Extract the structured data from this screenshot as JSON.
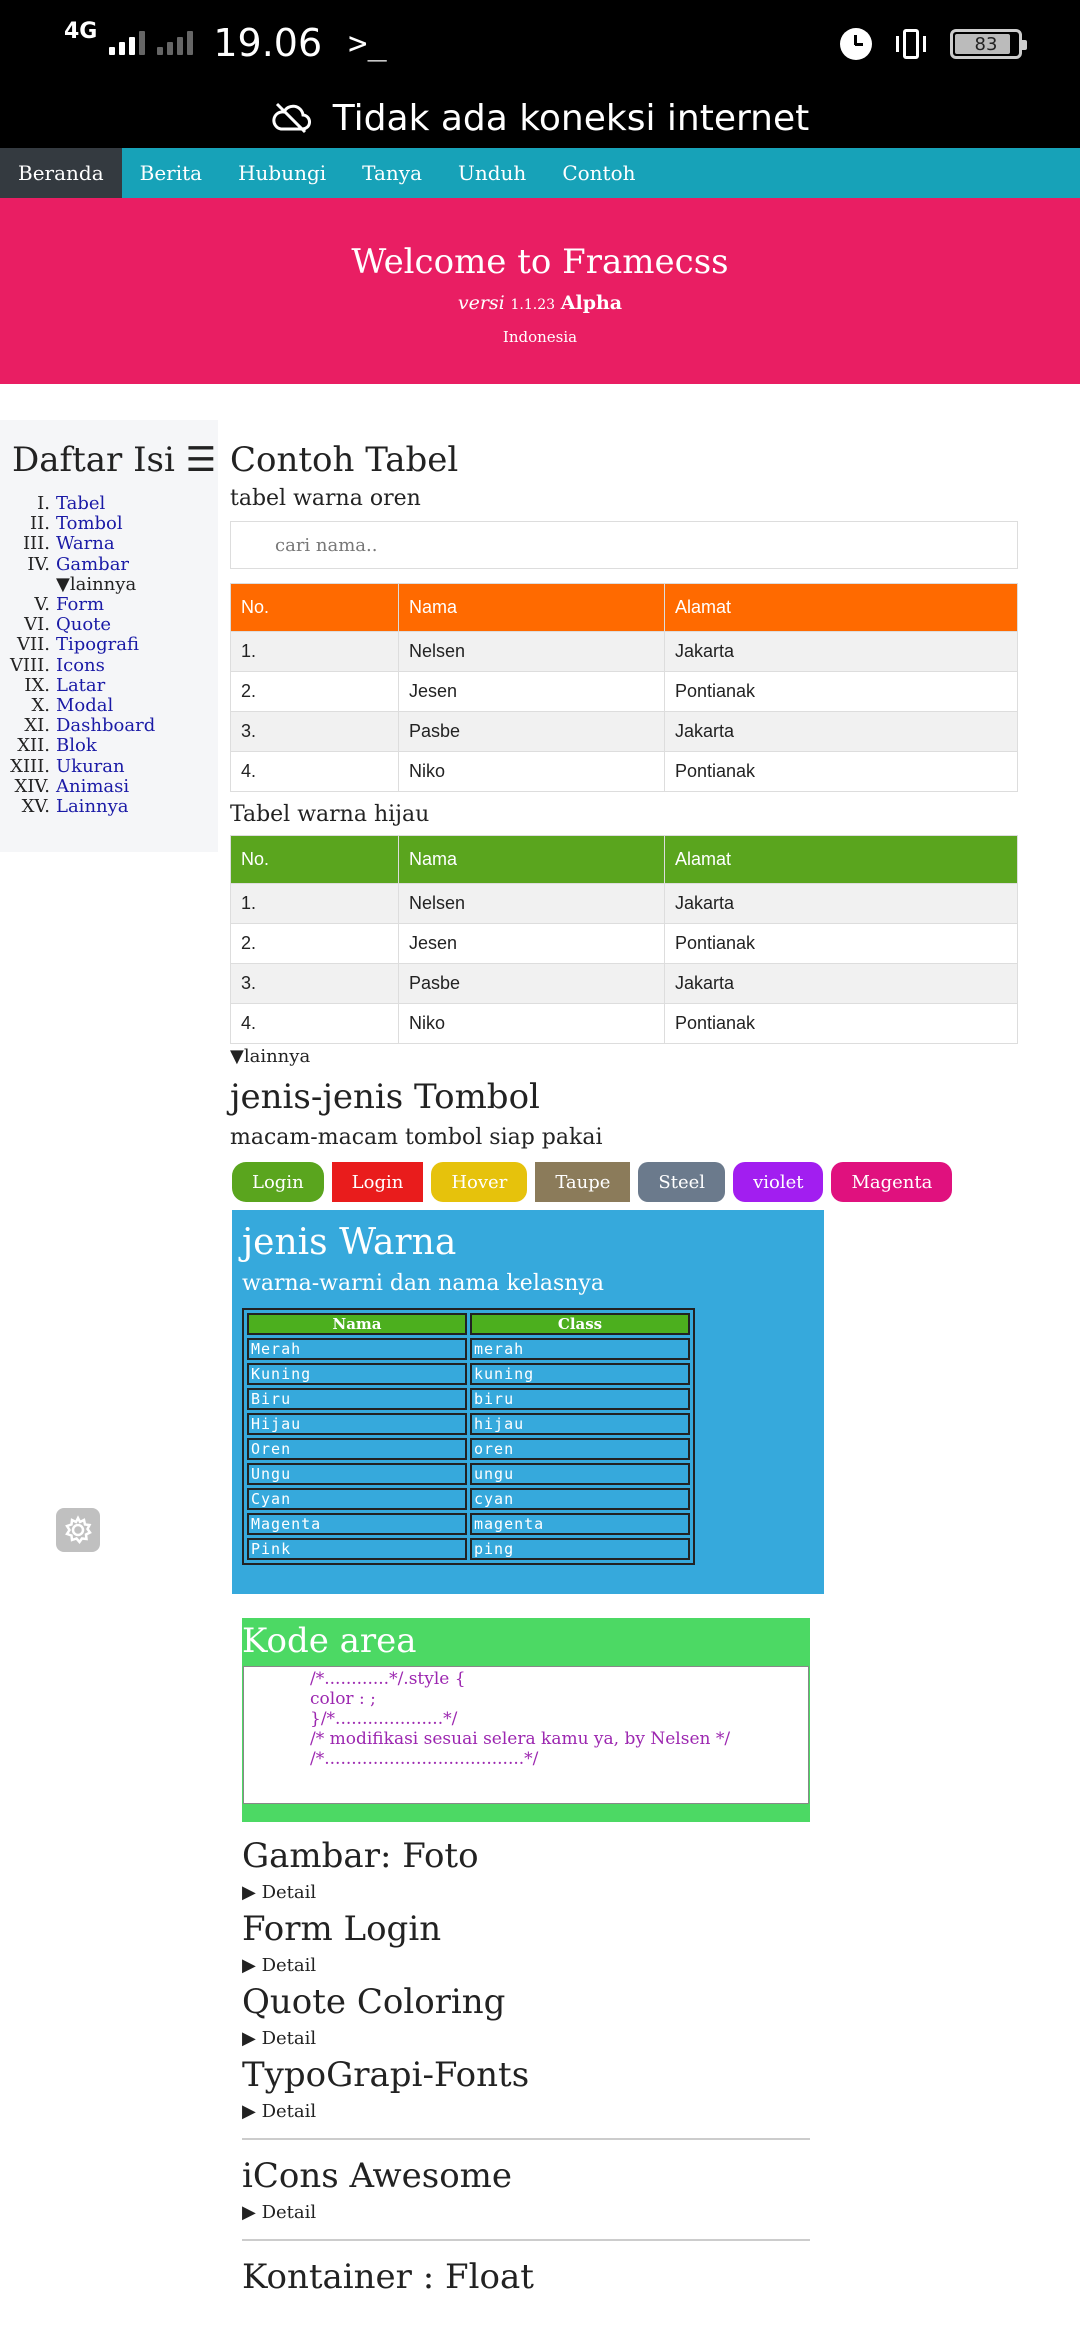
{
  "status": {
    "network": "4G",
    "time": "19.06",
    "prompt": ">_",
    "battery": "83"
  },
  "offline": {
    "message": "Tidak ada koneksi internet"
  },
  "nav": {
    "items": [
      "Beranda",
      "Berita",
      "Hubungi",
      "Tanya",
      "Unduh",
      "Contoh"
    ]
  },
  "hero": {
    "title": "Welcome to Framecss",
    "version_prefix": "versi",
    "version_number": "1.1.23",
    "version_stage": "Alpha",
    "country": "Indonesia"
  },
  "sidebar": {
    "title": "Daftar Isi ☰",
    "items": [
      {
        "num": "I.",
        "label": "Tabel"
      },
      {
        "num": "II.",
        "label": "Tombol"
      },
      {
        "num": "III.",
        "label": "Warna"
      },
      {
        "num": "IV.",
        "label": "Gambar"
      },
      {
        "num": "V.",
        "label": "Form"
      },
      {
        "num": "VI.",
        "label": "Quote"
      },
      {
        "num": "VII.",
        "label": "Tipografi"
      },
      {
        "num": "VIII.",
        "label": "Icons"
      },
      {
        "num": "IX.",
        "label": "Latar"
      },
      {
        "num": "X.",
        "label": "Modal"
      },
      {
        "num": "XI.",
        "label": "Dashboard"
      },
      {
        "num": "XII.",
        "label": "Blok"
      },
      {
        "num": "XIII.",
        "label": "Ukuran"
      },
      {
        "num": "XIV.",
        "label": "Animasi"
      },
      {
        "num": "XV.",
        "label": "Lainnya"
      }
    ],
    "sub_label": "▼lainnya"
  },
  "main": {
    "tabel_title": "Contoh Tabel",
    "tabel_oren_label": "tabel warna oren",
    "search_placeholder": "cari nama..",
    "tabel_hijau_label": "Tabel warna hijau",
    "columns": [
      "No.",
      "Nama",
      "Alamat"
    ],
    "rows": [
      [
        "1.",
        "Nelsen",
        "Jakarta"
      ],
      [
        "2.",
        "Jesen",
        "Pontianak"
      ],
      [
        "3.",
        "Pasbe",
        "Jakarta"
      ],
      [
        "4.",
        "Niko",
        "Pontianak"
      ]
    ],
    "lainnya": "▼lainnya",
    "tombol_title": "jenis-jenis Tombol",
    "tombol_subtitle": "macam-macam tombol siap pakai",
    "buttons": [
      {
        "label": "Login",
        "color": "#5aa51e"
      },
      {
        "label": "Login",
        "color": "#e91c1c"
      },
      {
        "label": "Hover",
        "color": "#e6c20c"
      },
      {
        "label": "Taupe",
        "color": "#8b7b5a"
      },
      {
        "label": "Steel",
        "color": "#6b7a8c"
      },
      {
        "label": "violet",
        "color": "#a21ef0"
      },
      {
        "label": "Magenta",
        "color": "#e0117e"
      }
    ],
    "warna_title": "jenis Warna",
    "warna_subtitle": "warna-warni dan nama kelasnya",
    "warna_columns": [
      "Nama",
      "Class"
    ],
    "warna_rows": [
      [
        "Merah",
        "merah"
      ],
      [
        "Kuning",
        "kuning"
      ],
      [
        "Biru",
        "biru"
      ],
      [
        "Hijau",
        "hijau"
      ],
      [
        "Oren",
        "oren"
      ],
      [
        "Ungu",
        "ungu"
      ],
      [
        "Cyan",
        "cyan"
      ],
      [
        "Magenta",
        "magenta"
      ],
      [
        "Pink",
        "ping"
      ]
    ],
    "kode_title": "Kode area",
    "kode_lines": [
      "/*............*/.style {",
      "color : ;",
      "}/*....................*/",
      "/* modifikasi sesuai selera kamu ya, by Nelsen */",
      "/*.....................................*/"
    ],
    "sections": [
      {
        "title": "Gambar: Foto",
        "summary": "▶ Detail"
      },
      {
        "title": "Form Login",
        "summary": "▶ Detail"
      },
      {
        "title": "Quote Coloring",
        "summary": "▶ Detail"
      },
      {
        "title": "TypoGrapi-Fonts",
        "summary": "▶ Detail"
      },
      {
        "title": "iCons Awesome",
        "summary": "▶ Detail"
      },
      {
        "title": "Kontainer : Float",
        "summary": ""
      }
    ]
  },
  "colors": {
    "orange": "#ff6a00",
    "green": "#5aa51e",
    "pink": "#e91e63",
    "teal": "#17a2b8",
    "blue": "#36a9dc",
    "kode_green": "#4cd964"
  }
}
